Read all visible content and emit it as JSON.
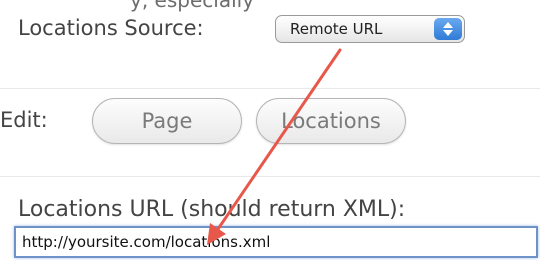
{
  "top_fragment": "y, especially",
  "locations_source": {
    "label": "Locations Source:",
    "selected": "Remote URL"
  },
  "edit": {
    "label": "Edit:",
    "buttons": [
      "Page",
      "Locations"
    ]
  },
  "locations_url": {
    "label": "Locations URL (should return XML):",
    "value": "http://yoursite.com/locations.xml"
  },
  "colors": {
    "annotation_arrow": "#e8584a",
    "select_stepper": "#2f7bd6",
    "input_focus_border": "#6f93c9"
  },
  "icons": {
    "select_stepper": "up-down-stepper-icon",
    "annotation": "red-arrow-annotation"
  }
}
